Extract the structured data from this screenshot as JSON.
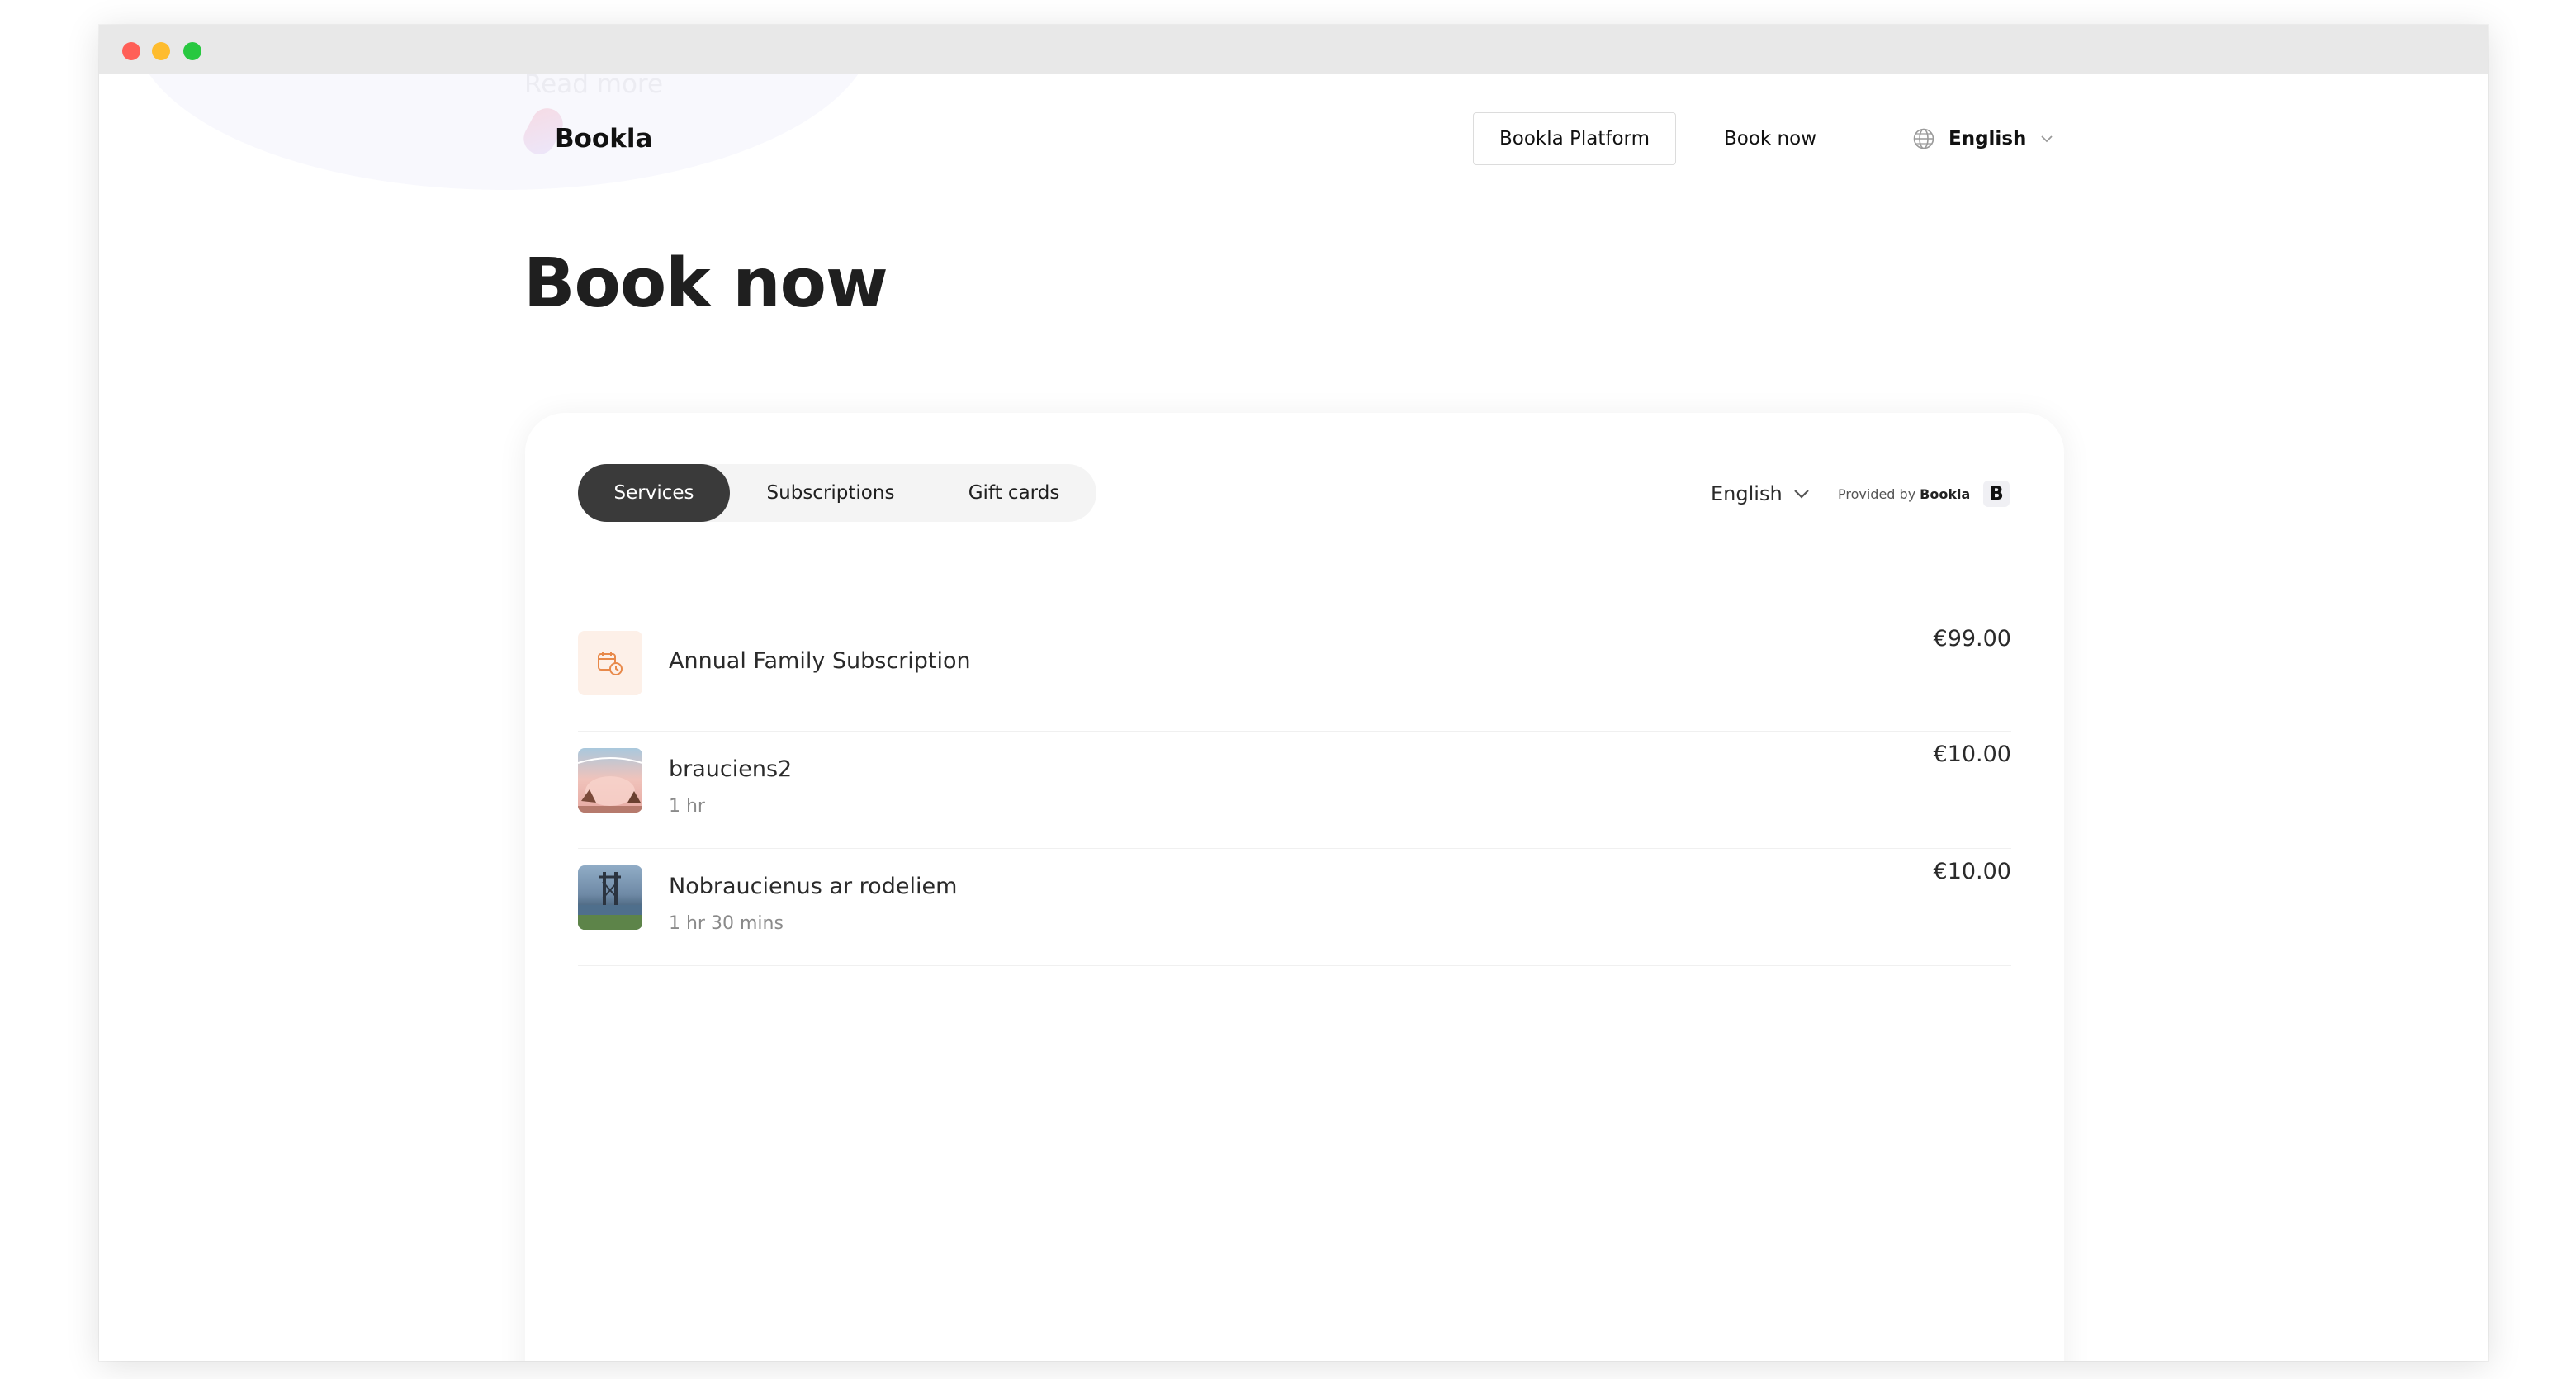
{
  "window": {
    "controls": [
      "close",
      "minimize",
      "maximize"
    ]
  },
  "background": {
    "ghost_text": "Read more"
  },
  "header": {
    "logo_text": "Bookla",
    "platform_button": "Bookla Platform",
    "book_now_link": "Book now",
    "language": "English",
    "globe_icon": "globe-icon",
    "chevron_icon": "chevron-down-icon"
  },
  "page": {
    "title": "Book now"
  },
  "widget": {
    "tabs": [
      {
        "label": "Services",
        "active": true
      },
      {
        "label": "Subscriptions",
        "active": false
      },
      {
        "label": "Gift cards",
        "active": false
      }
    ],
    "language": "English",
    "provided_label": "Provided by",
    "provided_brand": "Bookla",
    "provided_logo": "B",
    "services": [
      {
        "name": "Annual Family Subscription",
        "duration": "",
        "price": "€99.00",
        "thumb": "calendar-refresh-icon"
      },
      {
        "name": "brauciens2",
        "duration": "1 hr",
        "price": "€10.00",
        "thumb": "service-photo"
      },
      {
        "name": "Nobraucienus ar rodeliem",
        "duration": "1 hr 30 mins",
        "price": "€10.00",
        "thumb": "service-photo"
      }
    ]
  },
  "colors": {
    "active_tab": "#3a3a3a",
    "tab_track": "#f4f4f4",
    "subscription_icon_bg": "#fdf0e8",
    "subscription_icon": "#e8894a"
  }
}
